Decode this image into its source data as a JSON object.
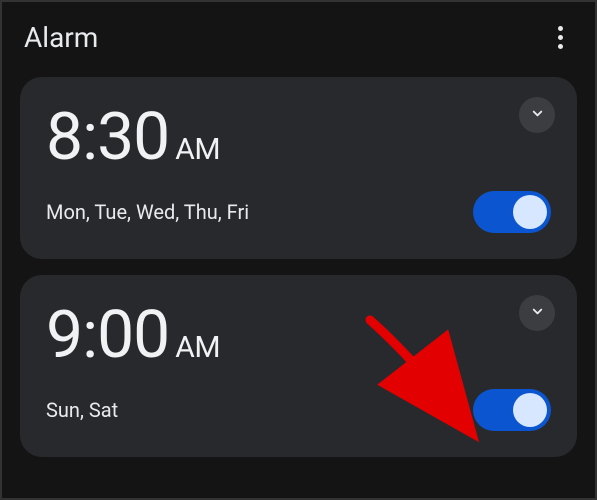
{
  "header": {
    "title": "Alarm"
  },
  "alarms": [
    {
      "time": "8:30",
      "period": "AM",
      "days": "Mon, Tue, Wed, Thu, Fri",
      "enabled": true
    },
    {
      "time": "9:00",
      "period": "AM",
      "days": "Sun, Sat",
      "enabled": true
    }
  ]
}
